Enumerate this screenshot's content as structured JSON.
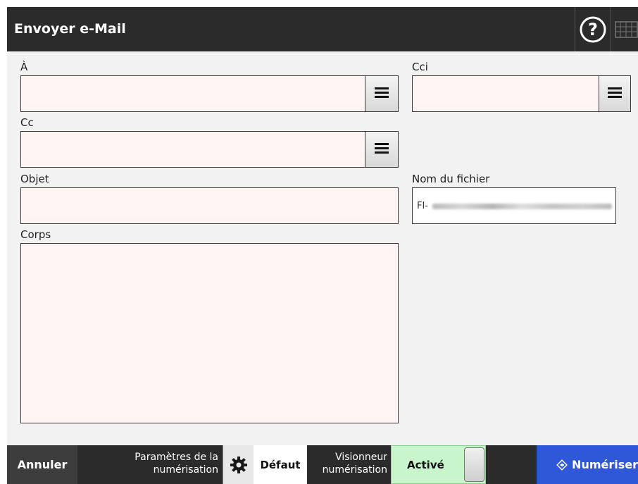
{
  "window": {
    "title": "Envoyer e-Mail",
    "help_icon": "help-circle-icon",
    "keyboard_icon": "keyboard-icon"
  },
  "form": {
    "to": {
      "label": "À",
      "value": ""
    },
    "cc": {
      "label": "Cc",
      "value": ""
    },
    "bcc": {
      "label": "Cci",
      "value": ""
    },
    "subject": {
      "label": "Objet",
      "value": ""
    },
    "body": {
      "label": "Corps",
      "value": ""
    },
    "filename": {
      "label": "Nom du fichier",
      "prefix": "FI-"
    },
    "list_icon": "list-icon"
  },
  "bottom_bar": {
    "cancel": "Annuler",
    "scan_settings_line1": "Paramètres de la",
    "scan_settings_line2": "numérisation",
    "settings_icon": "gear-icon",
    "default_button": "Défaut",
    "viewer_line1": "Visionneur",
    "viewer_line2": "numérisation",
    "viewer_toggle": "Activé",
    "scan_button": "Numériser",
    "scan_icon": "diamond-arrow-icon"
  },
  "colors": {
    "title_bar": "#2b2b2b",
    "field_bg": "#fff5f5",
    "toggle_on": "#c8f5cc",
    "scan_button": "#2f58d8"
  }
}
